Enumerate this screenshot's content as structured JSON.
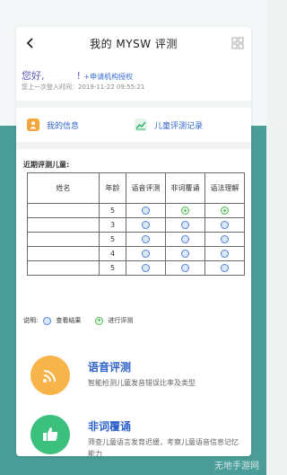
{
  "nav": {
    "back_icon": "chevron-left-icon",
    "title": "我的 MYSW 评测",
    "menu_icon": "grid-icon"
  },
  "user": {
    "greeting": "您好,",
    "name_separator": "!",
    "apply_link": "+申请机构授权",
    "last_login": "您上一次登入时间：2019-11-22 09:55:21"
  },
  "links": {
    "my_info": "我的信息",
    "child_records": "儿童评测记录"
  },
  "table": {
    "title": "近期评测儿童:",
    "headers": {
      "name": "姓名",
      "age": "年龄",
      "speech": "语音评测",
      "nonword": "非词覆诵",
      "grammar": "语法理解"
    },
    "rows": [
      {
        "name": "",
        "age": "5",
        "speech": "view",
        "nonword": "start",
        "grammar": "start"
      },
      {
        "name": "",
        "age": "3",
        "speech": "view",
        "nonword": "view",
        "grammar": "view"
      },
      {
        "name": "",
        "age": "5",
        "speech": "view",
        "nonword": "view",
        "grammar": "view"
      },
      {
        "name": "",
        "age": "4",
        "speech": "view",
        "nonword": "view",
        "grammar": "view"
      },
      {
        "name": "",
        "age": "5",
        "speech": "view",
        "nonword": "view",
        "grammar": "view"
      }
    ]
  },
  "legend": {
    "prefix": "说明:",
    "view": "查看结果",
    "start": "进行评测"
  },
  "features": [
    {
      "title": "语音评测",
      "desc": "智能检测儿童发音错误比率及类型",
      "icon": "wifi-signal-icon"
    },
    {
      "title": "非词覆诵",
      "desc": "筛查儿童语言发育迟缓，考察儿童语音信息记忆能力",
      "icon": "thumbs-up-icon"
    }
  ],
  "watermark": "无地手游网",
  "colors": {
    "teal": "#4a9d99",
    "accent_blue": "#2f63c9",
    "orange": "#f7b44a",
    "green": "#3cc07e"
  }
}
